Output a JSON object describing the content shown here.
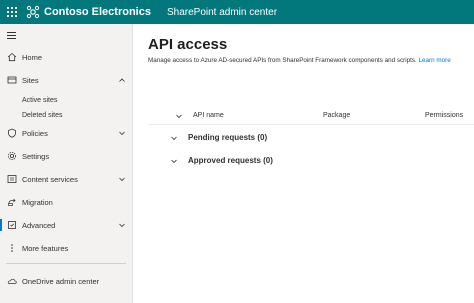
{
  "suite": {
    "org_name": "Contoso Electronics",
    "app_name": "SharePoint admin center",
    "brand_color": "#03787c",
    "waffle_icon": "app-launcher-icon",
    "logo_icon": "contoso-logo-icon"
  },
  "nav": {
    "toggle_icon": "hamburger-icon",
    "items": {
      "home": {
        "label": "Home",
        "icon": "home-icon"
      },
      "sites": {
        "label": "Sites",
        "icon": "sites-icon",
        "expanded": true
      },
      "active_sites": {
        "label": "Active sites"
      },
      "deleted_sites": {
        "label": "Deleted sites"
      },
      "policies": {
        "label": "Policies",
        "icon": "policies-icon",
        "expanded": false
      },
      "settings": {
        "label": "Settings",
        "icon": "gear-icon"
      },
      "content_services": {
        "label": "Content services",
        "icon": "content-services-icon",
        "expanded": false
      },
      "migration": {
        "label": "Migration",
        "icon": "migration-icon"
      },
      "advanced": {
        "label": "Advanced",
        "icon": "advanced-icon",
        "expanded": false,
        "selected": true
      },
      "more_features": {
        "label": "More features",
        "icon": "more-icon"
      },
      "onedrive": {
        "label": "OneDrive admin center",
        "icon": "onedrive-icon"
      }
    }
  },
  "page": {
    "title": "API access",
    "description": "Manage access to Azure AD-secured APIs from SharePoint Framework components and scripts.",
    "learn_more": "Learn more",
    "table": {
      "columns": [
        "API name",
        "Package",
        "Permissions"
      ],
      "groups": [
        {
          "label": "Pending requests (0)",
          "expanded": false
        },
        {
          "label": "Approved requests (0)",
          "expanded": false
        }
      ]
    }
  }
}
